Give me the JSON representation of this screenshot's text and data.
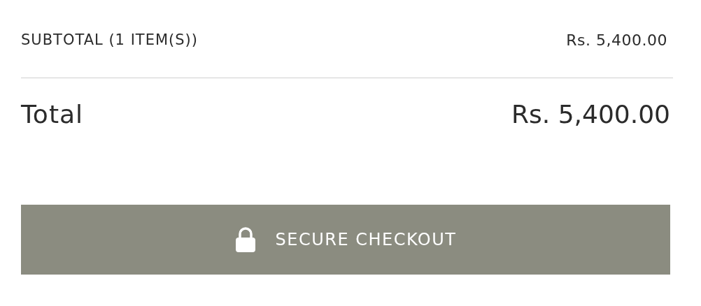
{
  "subtotal": {
    "label": "SUBTOTAL (1 ITEM(S))",
    "value": "Rs. 5,400.00"
  },
  "total": {
    "label": "Total",
    "value": "Rs. 5,400.00"
  },
  "checkout_button": {
    "label": "SECURE CHECKOUT"
  }
}
